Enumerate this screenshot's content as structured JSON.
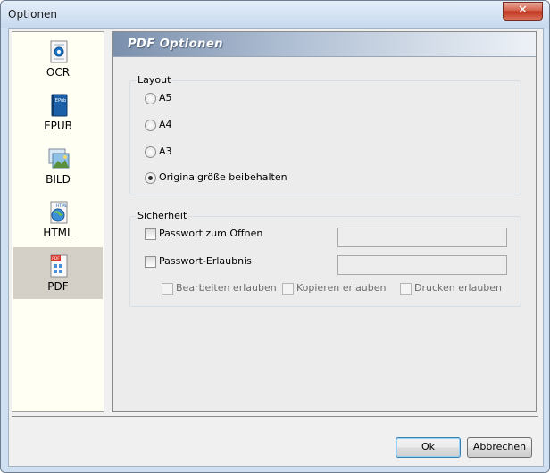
{
  "window": {
    "title": "Optionen",
    "close_symbol": "✕"
  },
  "sidebar": {
    "items": [
      {
        "label": "OCR",
        "icon": "ocr-icon"
      },
      {
        "label": "EPUB",
        "icon": "epub-icon",
        "icon_text": "EPub"
      },
      {
        "label": "BILD",
        "icon": "image-icon"
      },
      {
        "label": "HTML",
        "icon": "html-icon",
        "icon_text": "HTML"
      },
      {
        "label": "PDF",
        "icon": "pdf-icon",
        "icon_text": "PDF",
        "selected": true
      }
    ]
  },
  "panel": {
    "title": "PDF Optionen",
    "layout": {
      "title": "Layout",
      "options": [
        {
          "label": "A5",
          "checked": false
        },
        {
          "label": "A4",
          "checked": false
        },
        {
          "label": "A3",
          "checked": false
        },
        {
          "label": "Originalgröße beibehalten",
          "checked": true
        }
      ]
    },
    "security": {
      "title": "Sicherheit",
      "open_password_label": "Passwort zum Öffnen",
      "open_password_value": "",
      "permission_password_label": "Passwort-Erlaubnis",
      "permission_password_value": "",
      "permissions": [
        {
          "label": "Bearbeiten erlauben"
        },
        {
          "label": "Kopieren erlauben"
        },
        {
          "label": "Drucken erlauben"
        }
      ]
    }
  },
  "buttons": {
    "ok": "Ok",
    "cancel": "Abbrechen"
  }
}
